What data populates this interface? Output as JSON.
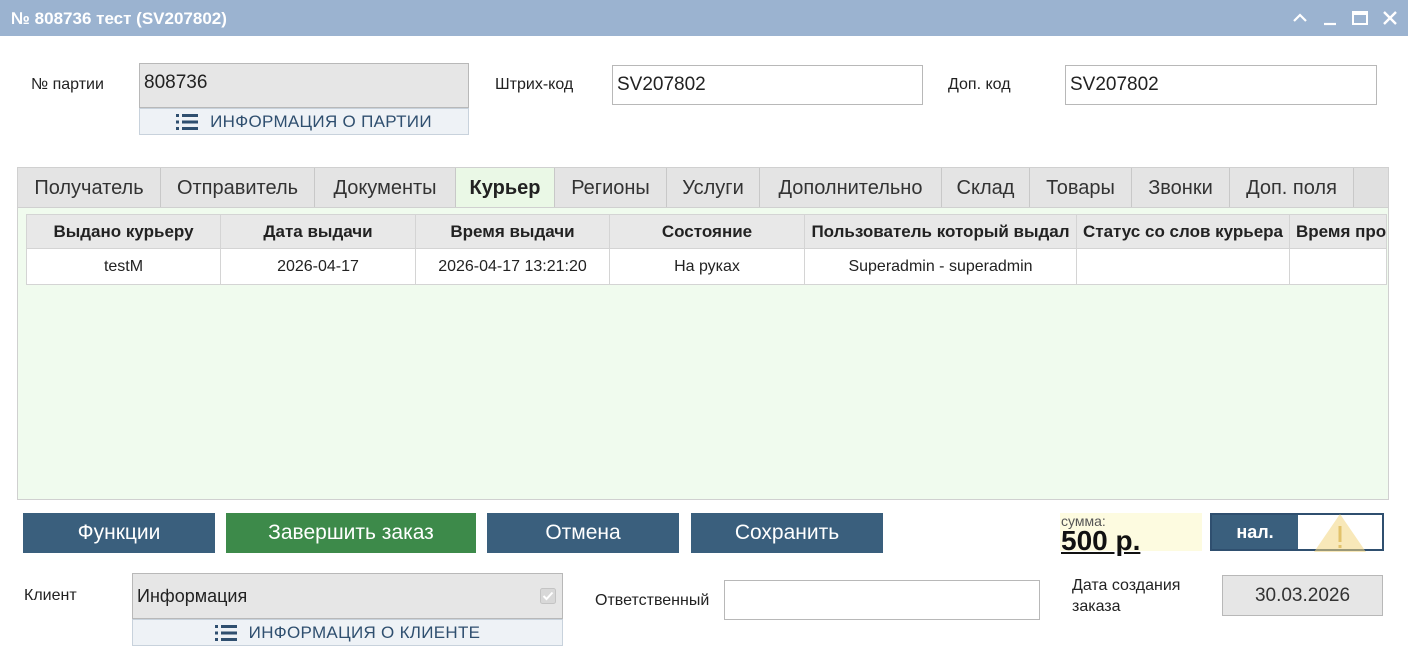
{
  "window": {
    "title": "№ 808736 тест (SV207802)"
  },
  "header": {
    "party_label": "№ партии",
    "party_value": "808736",
    "party_info_button": "ИНФОРМАЦИЯ О ПАРТИИ",
    "barcode_label": "Штрих-код",
    "barcode_value": "SV207802",
    "extra_code_label": "Доп. код",
    "extra_code_value": "SV207802"
  },
  "tabs": [
    {
      "label": "Получатель"
    },
    {
      "label": "Отправитель"
    },
    {
      "label": "Документы"
    },
    {
      "label": "Курьер",
      "active": true
    },
    {
      "label": "Регионы"
    },
    {
      "label": "Услуги"
    },
    {
      "label": "Дополнительно"
    },
    {
      "label": "Склад"
    },
    {
      "label": "Товары"
    },
    {
      "label": "Звонки"
    },
    {
      "label": "Доп. поля"
    }
  ],
  "courier_table": {
    "columns": [
      "Выдано курьеру",
      "Дата выдачи",
      "Время выдачи",
      "Состояние",
      "Пользователь который выдал",
      "Статус со слов курьера",
      "Время про"
    ],
    "rows": [
      [
        "testM",
        "2026-04-17",
        "2026-04-17 13:21:20",
        "На руках",
        "Superadmin - superadmin",
        "",
        ""
      ]
    ]
  },
  "actions": {
    "functions": "Функции",
    "complete": "Завершить заказ",
    "cancel": "Отмена",
    "save": "Сохранить"
  },
  "summary": {
    "caption": "сумма:",
    "value": "500 р.",
    "payment_method": "нал."
  },
  "footer": {
    "client_label": "Клиент",
    "client_value": "Информация",
    "client_info_button": "ИНФОРМАЦИЯ О КЛИЕНТЕ",
    "responsible_label": "Ответственный",
    "responsible_value": "",
    "created_label": "Дата создания заказа",
    "created_value": "30.03.2026"
  },
  "colors": {
    "titlebar": "#9bb3d0",
    "primary_button": "#3a5f7d",
    "success_button": "#3d8a4a",
    "panel_bg": "#f0fbee",
    "warning_icon": "#f2d680"
  },
  "icons": {
    "list": "list-icon",
    "collapse": "chevron-up-icon",
    "minimize": "minimize-icon",
    "maximize": "maximize-icon",
    "close": "close-icon",
    "warning": "warning-icon",
    "checkbox": "checkbox-checked-icon"
  }
}
